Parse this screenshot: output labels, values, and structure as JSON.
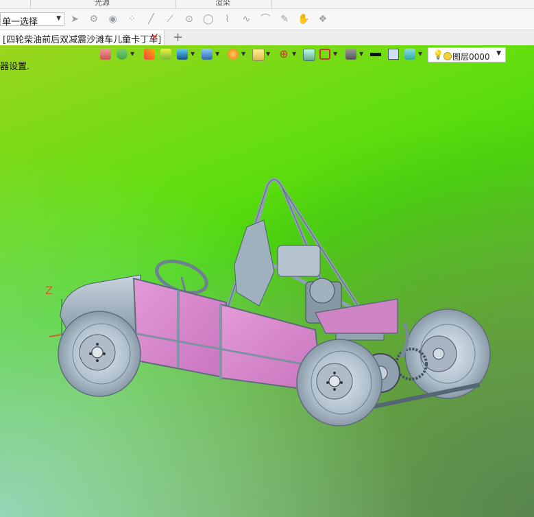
{
  "ribbon": {
    "groups": [
      {
        "label": "光源"
      },
      {
        "label": "渲染"
      }
    ]
  },
  "toolbar": {
    "selection_mode": "单一选择",
    "tools": [
      "pointer-icon",
      "gear-cursor-icon",
      "play-icon",
      "dots-icon",
      "line-icon",
      "arc-line-icon",
      "circle-center-icon",
      "circle-icon",
      "polyline-icon",
      "spline-icon",
      "arch-icon",
      "pen-icon",
      "hand-icon",
      "paint-icon"
    ]
  },
  "tabs": [
    {
      "label": "[四轮柴油前后双减震沙滩车儿童卡丁车]",
      "active": true
    }
  ],
  "new_tab_label": "+",
  "viewport": {
    "status_message": "器设置.",
    "layer": "图层0000",
    "axis_z_label": "Z",
    "icons": [
      "import-icon",
      "user-icon",
      "brush-icon",
      "cube-yellow-icon",
      "cube-blue-icon",
      "cube-split-icon",
      "compass-icon",
      "view-box-icon",
      "origin-icon",
      "zoom-fit-icon",
      "ruler-icon",
      "display-icon",
      "line-color-icon",
      "fill-color-icon",
      "layer-icon"
    ]
  },
  "colors": {
    "body_panel": "#d580c8",
    "frame": "#8fa3b8",
    "tire": "#a9b8c6",
    "axis": "#d0602a"
  }
}
